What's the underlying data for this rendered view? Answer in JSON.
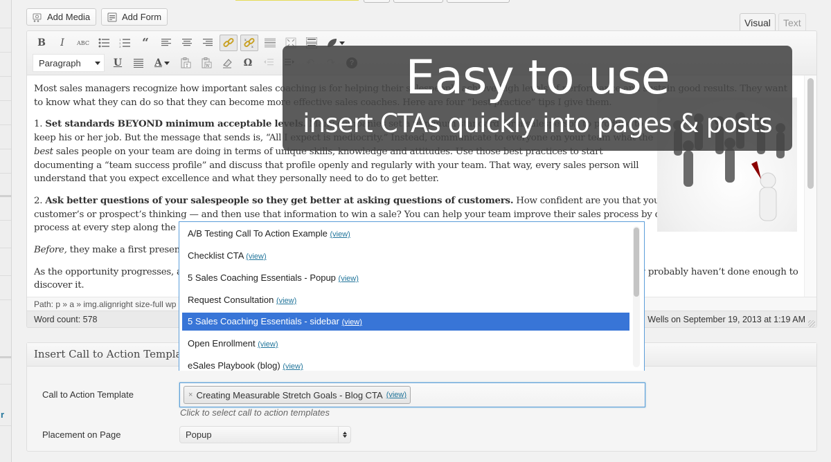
{
  "media_buttons": {
    "add_media": "Add Media",
    "add_form": "Add Form"
  },
  "editor_tabs": {
    "visual": "Visual",
    "text": "Text",
    "active": "Visual"
  },
  "toolbar": {
    "row1": [
      "bold",
      "italic",
      "strikethrough",
      "bulleted-list",
      "numbered-list",
      "blockquote",
      "align-left",
      "align-center",
      "align-right",
      "insert-link",
      "unlink",
      "insert-more-tag",
      "fullscreen",
      "toolbar-toggle",
      "leaf-plugin"
    ],
    "format_select": "Paragraph",
    "row2": [
      "underline",
      "justify",
      "text-color",
      "paste-as-text",
      "paste-from-word",
      "clear-formatting",
      "special-character",
      "outdent",
      "indent",
      "undo",
      "redo",
      "help"
    ]
  },
  "content": {
    "p1": "Most sales managers recognize how important sales coaching is for helping their salespeople achieve high levels of performance and sustain good results. They want to know what they can do so that they can become more effective sales coaches. Here are four “best practice” tips I give them.",
    "p2_num": "1. ",
    "p2_bold": "Set standards BEYOND minimum acceptable levels.",
    "p2_a": "  Many companies set a minimum standard for a salesperson to produce to keep his or her job. But the message that sends is, “All I expect is mediocrity.” Instead, communicate to everyone on your team what the ",
    "p2_em": "best",
    "p2_b": " sales people on your team are doing in terms of unique skills, knowledge and attitudes. Use those best practices to start documenting a “team success profile” and discuss that profile openly and regularly with your team. That way, every sales person will understand that you expect excellence and what they personally need to do to get better.",
    "p3_num": "2. ",
    "p3_bold": "Ask better questions of your salespeople so they get better at asking questions of customers.",
    "p3_a": " How confident are you that your salespeople can delve into a customer’s or prospect’s thinking — and then use that information to win a sale? You can help your team improve their sales process by drilling into a rep’s sales process at every step along the way.",
    "p4_em": "Before,",
    "p4_a": " they make a first presentation, ask them what they learned during discovery to make sure they did a good job of probing.",
    "p5": "As the opportunity progresses, ask them what the customer’s decision criteria are. If your salesperson can’t answer the question, they probably haven’t done enough to discover it."
  },
  "path_bar": "Path: p » a » img.alignright size-full wp",
  "status_bar": {
    "word_count": "Word count: 578",
    "last_edited": "Last edited by Ed Wells on September 19, 2013 at 1:19 AM"
  },
  "overlay": {
    "headline": "Easy to use",
    "subline": "insert CTAs quickly into pages & posts"
  },
  "cta_dropdown": {
    "items": [
      {
        "label": "A/B Testing Call To Action Example",
        "link": "(view)"
      },
      {
        "label": "Checklist CTA ",
        "link": "(view)"
      },
      {
        "label": "5 Sales Coaching Essentials - Popup",
        "link": "(view)"
      },
      {
        "label": "Request Consultation",
        "link": "(view)"
      },
      {
        "label": "5 Sales Coaching Essentials - sidebar",
        "link": "(view)"
      },
      {
        "label": "Open Enrollment",
        "link": "(view)"
      },
      {
        "label": "eSales Playbook (blog)",
        "link": "(view)"
      }
    ],
    "selected_index": 4
  },
  "metabox": {
    "title": "Insert Call to Action Template",
    "cta_label": "Call to Action Template",
    "selected_chip": "Creating Measurable Stretch Goals - Blog CTA",
    "chip_link": "(view)",
    "chip_remove": "×",
    "hint": "Click to select call to action templates",
    "placement_label": "Placement on Page",
    "placement_value": "Popup"
  },
  "sidebar_fragment": "r",
  "colors": {
    "selection_blue": "#3875d7",
    "link_blue": "#21759b",
    "focus_border": "#5b9dd9"
  }
}
